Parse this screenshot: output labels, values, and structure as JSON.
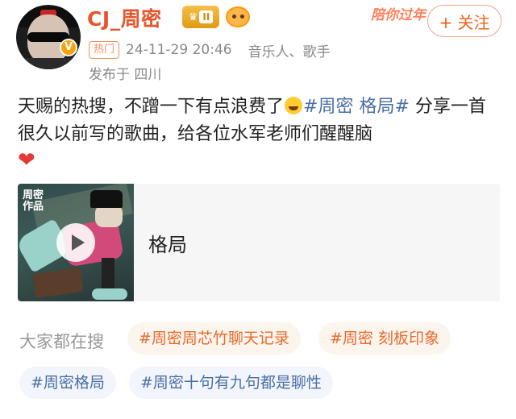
{
  "post": {
    "username": "CJ_周密",
    "level_badge": "II",
    "promo_text": "陪你过年",
    "follow_label": "+ 关注",
    "hot_tag": "热门",
    "timestamp": "24-11-29 20:46",
    "tags": "音乐人、歌手",
    "location": "发布于 四川",
    "text_part1": "天赐的热搜，不蹭一下有点浪费了",
    "topic": "#周密 格局#",
    "text_part2": " 分享一首很久以前写的歌曲，给各位水军老师们醒醒脑",
    "heart": "❤"
  },
  "music": {
    "cover_text": "周密\n作品",
    "title": "格局"
  },
  "trending": {
    "label": "大家都在搜",
    "chips": [
      "#周密周芯竹聊天记录",
      "#周密 刻板印象",
      "#周密格局",
      "#周密十句有九句都是聊性"
    ]
  },
  "colors": {
    "username": "#e8542b",
    "topic": "#4a6fa5",
    "chip_orange": "#e86a2c",
    "chip_blue": "#4a6fa5"
  },
  "icons": [
    "avatar",
    "verified-icon",
    "crown-badge-icon",
    "fan-badge-icon",
    "laugh-emoji-icon",
    "heart-icon",
    "play-icon"
  ]
}
